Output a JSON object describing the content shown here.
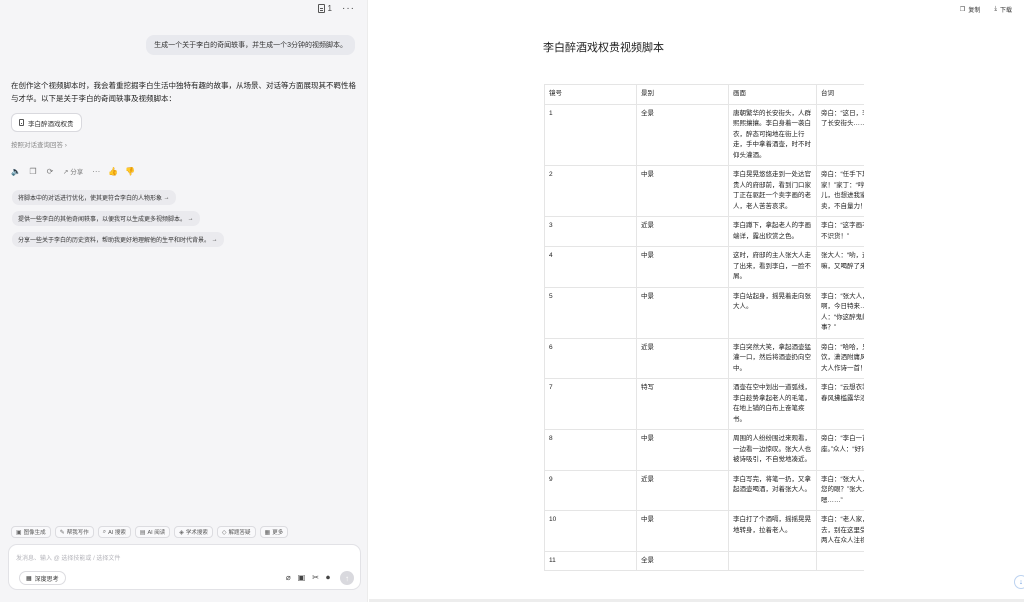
{
  "left_panel": {
    "doc_count": "1",
    "user_message": "生成一个关于李白的奇闻轶事，并生成一个3分钟的视频脚本。",
    "ai_response": "在创作这个视频脚本时，我会着重挖掘李白生活中独特有趣的故事，从场景、对话等方面展现其不羁性格与才华。以下是关于李白的奇闻轶事及视频脚本：",
    "doc_chip": "李白醉酒戏权贵",
    "trace_label": "按照对话查询回答",
    "actions": {
      "share": "分享"
    },
    "suggestions": [
      "将脚本中的对话进行优化，使其更符合李白的人物形象",
      "提供一些李白的其他奇闻轶事，以便我可以生成更多视频脚本。",
      "分享一些关于李白的历史资料，帮助我更好地理解他的生平和时代背景。"
    ],
    "tools": [
      "图像生成",
      "帮我写作",
      "AI 搜索",
      "AI 阅读",
      "学术搜索",
      "解题答疑",
      "更多"
    ],
    "input_placeholder": "发消息、输入 @ 选择技能或 / 选择文件",
    "deep_think": "深度思考"
  },
  "right_panel": {
    "copy_label": "复制",
    "download_label": "下载",
    "doc_title": "李白醉酒戏权贵视频脚本",
    "table": {
      "headers": [
        "镜号",
        "景别",
        "画面",
        "台词"
      ],
      "rows": [
        [
          "1",
          "全景",
          "唐朝繁华的长安街头，人群熙熙攘攘。李白身着一袭白衣，醉态可掬地在街上行走，手中拿着酒壶，时不时仰头灌酒。",
          "旁白：“这日，李白又醉在了长安街头……”"
        ],
        [
          "2",
          "中景",
          "李白晃晃悠悠走到一处达官贵人的府邸前，看到门口家丁正在驱赶一个卖字画的老人，老人苦苦哀求。",
          "旁白：“任手下欺负这老人家！”家丁：“哼，这老头儿，也想进我家大人府里卖，不自量力！”"
        ],
        [
          "3",
          "近景",
          "李白蹲下，拿起老人的字画端详，露出欣赏之色。",
          "李白：“这字画不错，你们不识货！”"
        ],
        [
          "4",
          "中景",
          "这时，府邸的主人张大人走了出来，看到李白，一脸不屑。",
          "张大人：“哟，这不是李白嘛，又喝醉了来这撒野？”"
        ],
        [
          "5",
          "中景",
          "李白站起身，摇晃着走向张大人。",
          "李白：“张大人，非也非也啊，今日特来……”张大人：“你这醉鬼能有什么事？”"
        ],
        [
          "6",
          "近景",
          "李白突然大笑，拿起酒壶猛灌一口，然后将酒壶扔向空中。",
          "旁白：“哈哈，只见李白豪饮，潇洒附庸风雅，誓要为大人作诗一首！”"
        ],
        [
          "7",
          "特写",
          "酒壶在空中划出一道弧线，李白趁势拿起老人的毛笔，在地上铺的白布上奋笔疾书。",
          "李白：“云想衣裳花想容，春风拂槛露华浓……”"
        ],
        [
          "8",
          "中景",
          "周围的人纷纷围过来观看，一边看一边惊叹。张大人也被诗吸引，不自觉地凑近。",
          "旁白：“李白一首诗惊四座。”众人：“好诗！好诗！”"
        ],
        [
          "9",
          "近景",
          "李白写完，将笔一扔，又拿起酒壶喝酒，对着张大人。",
          "李白：“张大人，可入得了您的眼？”张大人：“这……嗯……”"
        ],
        [
          "10",
          "中景",
          "李白打了个酒嗝，摇摇晃晃地转身，拉着老人。",
          "李白：“老人家，咱们喝酒去，别在这里受气了。”随后两人在众人注视下离去。"
        ],
        [
          "11",
          "全景",
          "",
          ""
        ]
      ]
    }
  }
}
